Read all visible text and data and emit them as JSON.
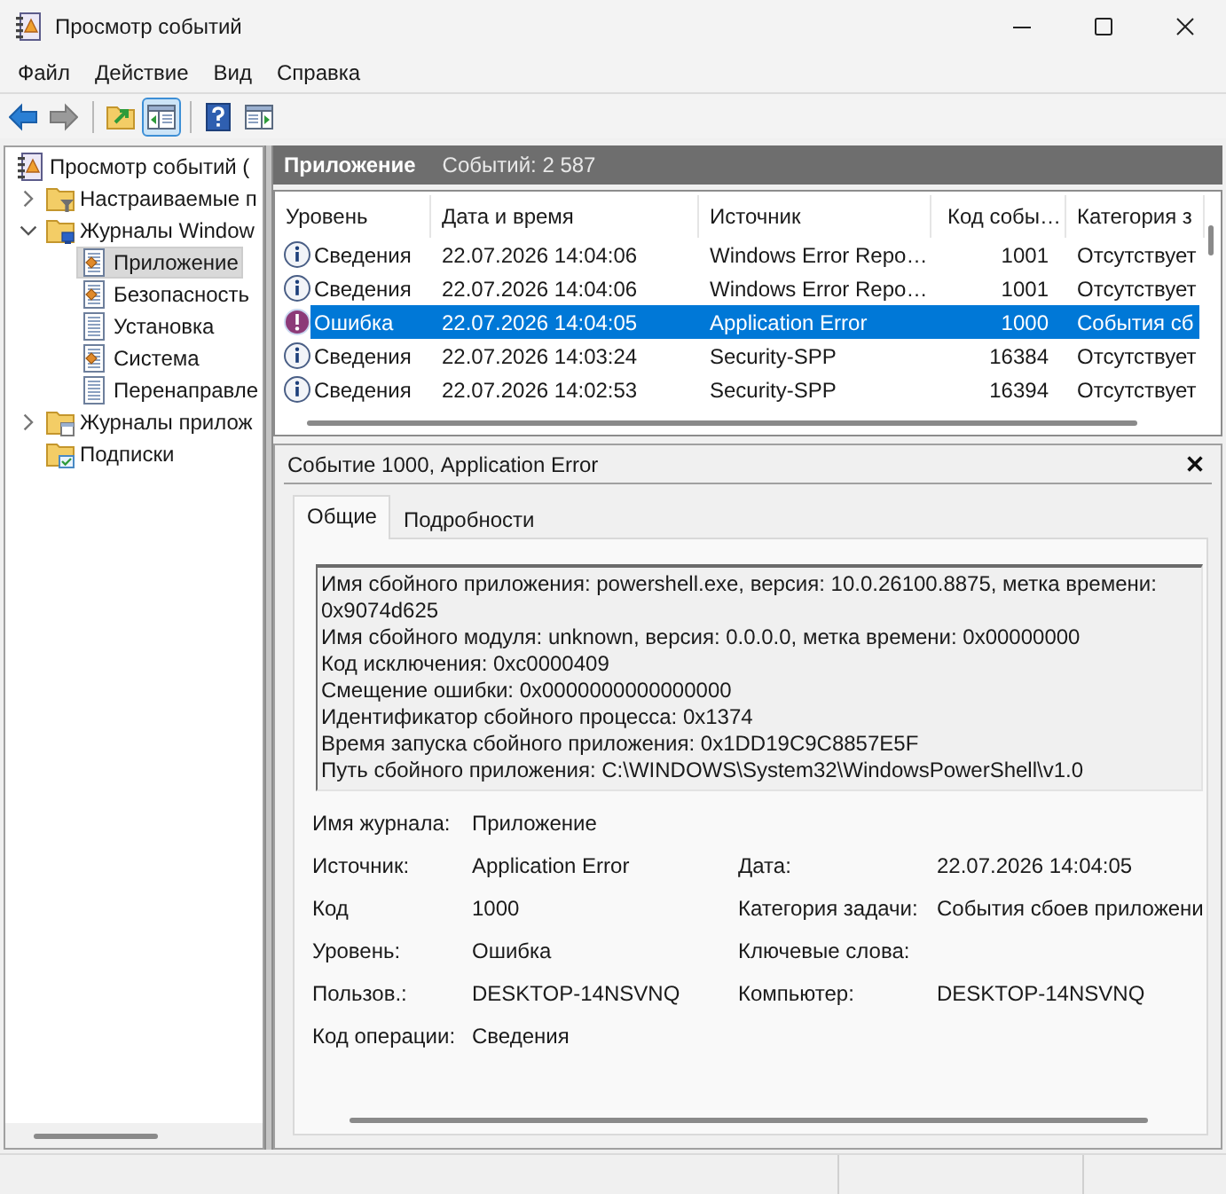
{
  "window": {
    "title": "Просмотр событий"
  },
  "menu": [
    {
      "label": "Файл"
    },
    {
      "label": "Действие"
    },
    {
      "label": "Вид"
    },
    {
      "label": "Справка"
    }
  ],
  "toolbar": [
    {
      "kind": "back",
      "disabled": false,
      "pressed": false
    },
    {
      "kind": "forward",
      "disabled": true,
      "pressed": false
    },
    {
      "kind": "separator"
    },
    {
      "kind": "up_folder",
      "disabled": false,
      "pressed": false
    },
    {
      "kind": "console_tree",
      "disabled": false,
      "pressed": true
    },
    {
      "kind": "separator"
    },
    {
      "kind": "help",
      "disabled": false,
      "pressed": false
    },
    {
      "kind": "action_pane",
      "disabled": false,
      "pressed": false
    }
  ],
  "tree": {
    "items": [
      {
        "label": "Просмотр событий (",
        "kind": "event_viewer",
        "selected": false,
        "children": [
          {
            "label": "Настраиваемые п",
            "kind": "custom_views",
            "expanded": false,
            "selected": false
          },
          {
            "label": "Журналы Window",
            "kind": "windows_logs",
            "expanded": true,
            "selected": false,
            "children": [
              {
                "label": "Приложение",
                "kind": "log_marked",
                "selected": true
              },
              {
                "label": "Безопасность",
                "kind": "log_marked",
                "selected": false
              },
              {
                "label": "Установка",
                "kind": "log",
                "selected": false
              },
              {
                "label": "Система",
                "kind": "log_marked",
                "selected": false
              },
              {
                "label": "Перенаправле",
                "kind": "log",
                "selected": false
              }
            ]
          },
          {
            "label": "Журналы прилож",
            "kind": "app_logs",
            "expanded": false,
            "selected": false
          },
          {
            "label": "Подписки",
            "kind": "subscriptions",
            "selected": false
          }
        ]
      }
    ]
  },
  "log_header": {
    "title": "Приложение",
    "count": "Событий: 2 587"
  },
  "events": {
    "columns": [
      {
        "label": "Уровень",
        "kind": "text"
      },
      {
        "label": "Дата и время",
        "kind": "text"
      },
      {
        "label": "Источник",
        "kind": "text"
      },
      {
        "label": "Код собы…",
        "kind": "number"
      },
      {
        "label": "Категория з",
        "kind": "text"
      }
    ],
    "rows": [
      {
        "kind": "info",
        "selected": false,
        "cells": [
          "Сведения",
          "22.07.2026 14:04:06",
          "Windows Error Repo…",
          "1001",
          "Отсутствует"
        ]
      },
      {
        "kind": "info",
        "selected": false,
        "cells": [
          "Сведения",
          "22.07.2026 14:04:06",
          "Windows Error Repo…",
          "1001",
          "Отсутствует"
        ]
      },
      {
        "kind": "error",
        "selected": true,
        "cells": [
          "Ошибка",
          "22.07.2026 14:04:05",
          "Application Error",
          "1000",
          "События сб"
        ]
      },
      {
        "kind": "info",
        "selected": false,
        "cells": [
          "Сведения",
          "22.07.2026 14:03:24",
          "Security-SPP",
          "16384",
          "Отсутствует"
        ]
      },
      {
        "kind": "info",
        "selected": false,
        "cells": [
          "Сведения",
          "22.07.2026 14:02:53",
          "Security-SPP",
          "16394",
          "Отсутствует"
        ]
      }
    ]
  },
  "detail": {
    "title": "Событие 1000, Application Error",
    "tabs": [
      {
        "label": "Общие",
        "selected": true
      },
      {
        "label": "Подробности",
        "selected": false
      }
    ],
    "description": [
      "Имя сбойного приложения: powershell.exe, версия: 10.0.26100.8875, метка времени: 0x9074d625",
      "Имя сбойного модуля: unknown, версия: 0.0.0.0, метка времени: 0x00000000",
      "Код исключения: 0xc0000409",
      "Смещение ошибки: 0x0000000000000000",
      "Идентификатор сбойного процесса: 0x1374",
      "Время запуска сбойного приложения: 0x1DD19C9C8857E5F",
      "Путь сбойного приложения: C:\\WINDOWS\\System32\\WindowsPowerShell\\v1.0"
    ],
    "field_rows": [
      {
        "left": {
          "label": "Имя журнала:",
          "value": "Приложение"
        }
      },
      {
        "left": {
          "label": "Источник:",
          "value": "Application Error"
        },
        "right": {
          "label": "Дата:",
          "value": "22.07.2026 14:04:05"
        }
      },
      {
        "left": {
          "label": "Код",
          "value": "1000"
        },
        "right": {
          "label": "Категория задачи:",
          "value": "События сбоев приложени"
        }
      },
      {
        "left": {
          "label": "Уровень:",
          "value": "Ошибка"
        },
        "right": {
          "label": "Ключевые слова:"
        }
      },
      {
        "left": {
          "label": "Пользов.:",
          "value": "DESKTOP-14NSVNQ"
        },
        "right": {
          "label": "Компьютер:",
          "value": "DESKTOP-14NSVNQ"
        }
      },
      {
        "left": {
          "label": "Код операции:",
          "value": "Сведения"
        }
      }
    ]
  }
}
